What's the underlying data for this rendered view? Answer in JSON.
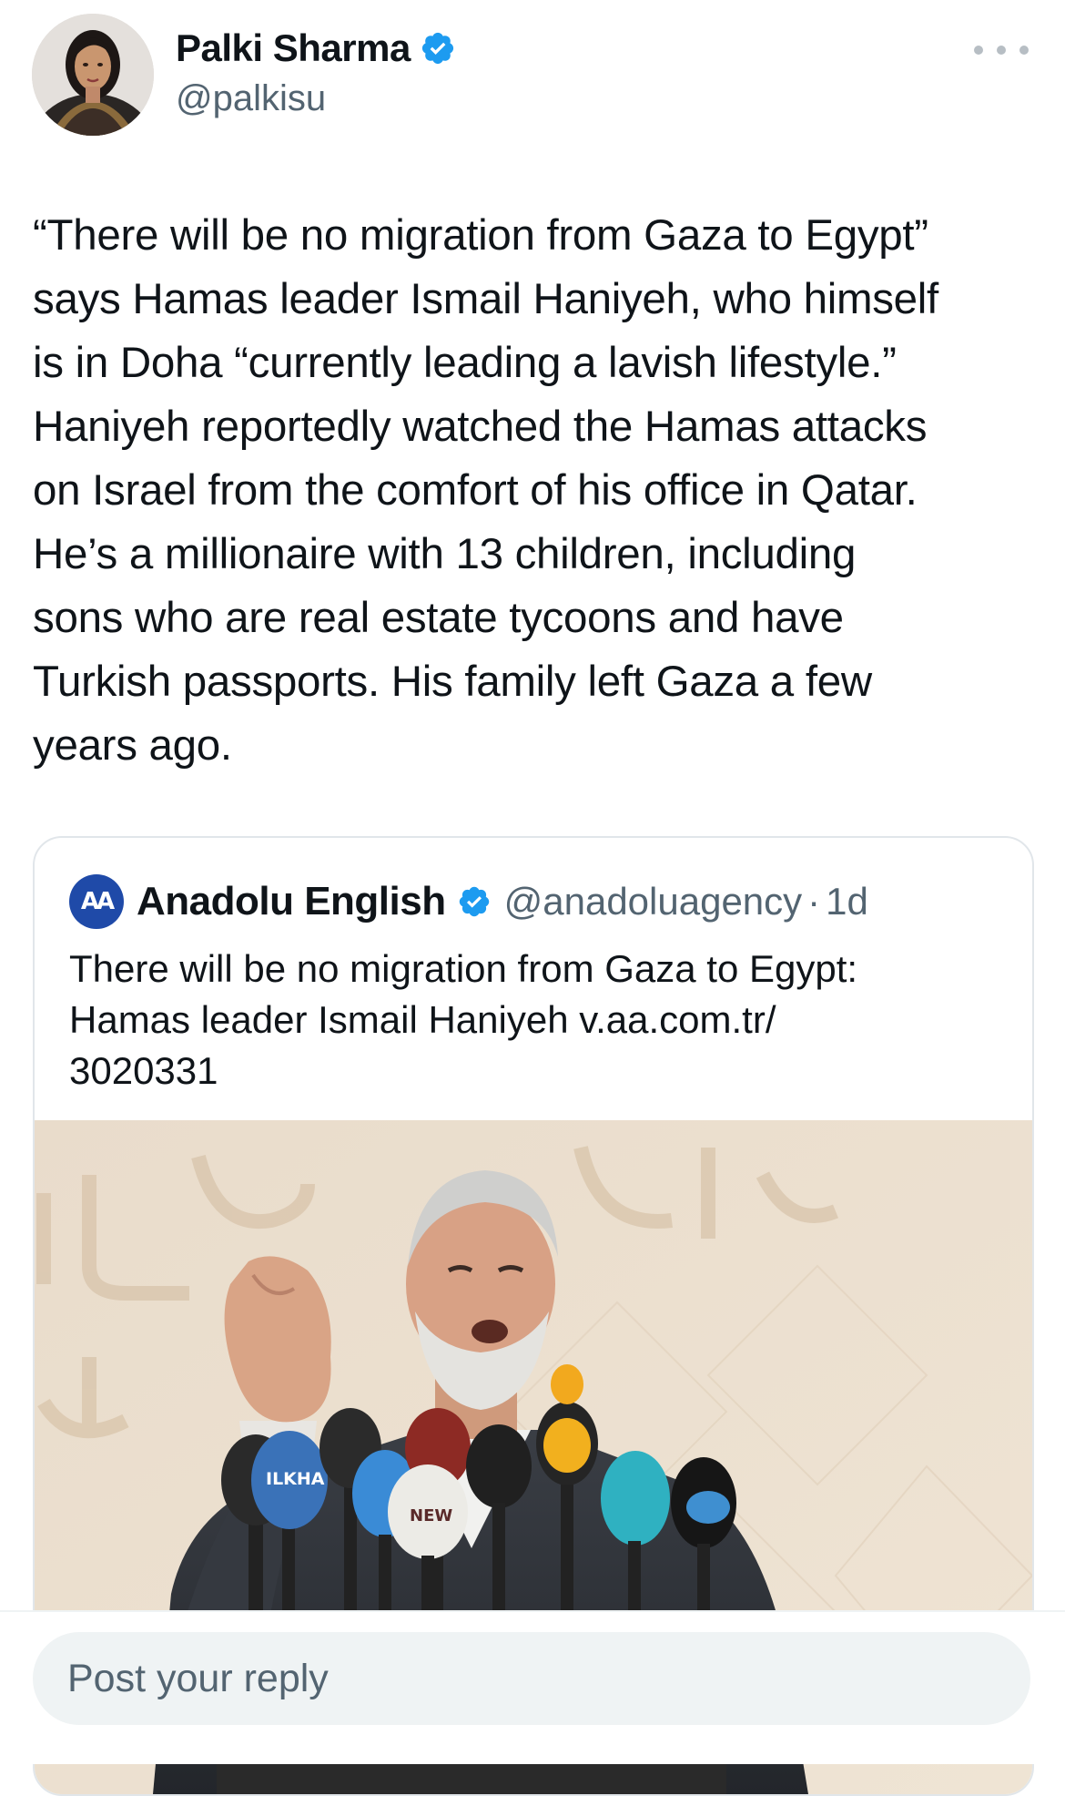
{
  "author": {
    "display_name": "Palki Sharma",
    "handle": "@palkisu",
    "verified": true,
    "avatar_icon": "profile-photo"
  },
  "tweet": {
    "text": "“There will be no migration from Gaza to Egypt”\nsays Hamas leader Ismail Haniyeh, who himself\nis in Doha “currently leading a lavish lifestyle.”\nHaniyeh reportedly watched the Hamas attacks\non Israel from the comfort of his office in Qatar.\nHe’s a millionaire with 13 children, including\nsons who are real estate tycoons and have\nTurkish passports. His family left Gaza a few\nyears ago."
  },
  "quoted": {
    "logo_text": "AA",
    "display_name": "Anadolu English",
    "handle": "@anadoluagency",
    "separator": "·",
    "time": "1d",
    "verified": true,
    "text": "There will be no migration from Gaza to Egypt:\nHamas leader Ismail Haniyeh v.aa.com.tr/\n3020331",
    "media": {
      "icon": "news-photo",
      "mic_labels": [
        "ILKHA",
        "NEW"
      ]
    }
  },
  "reply": {
    "placeholder": "Post your reply"
  },
  "colors": {
    "text": "#0f1419",
    "secondary": "#536471",
    "verified_blue": "#1d9bf0",
    "border": "#e1e6ea",
    "input_bg": "#eff3f4"
  }
}
